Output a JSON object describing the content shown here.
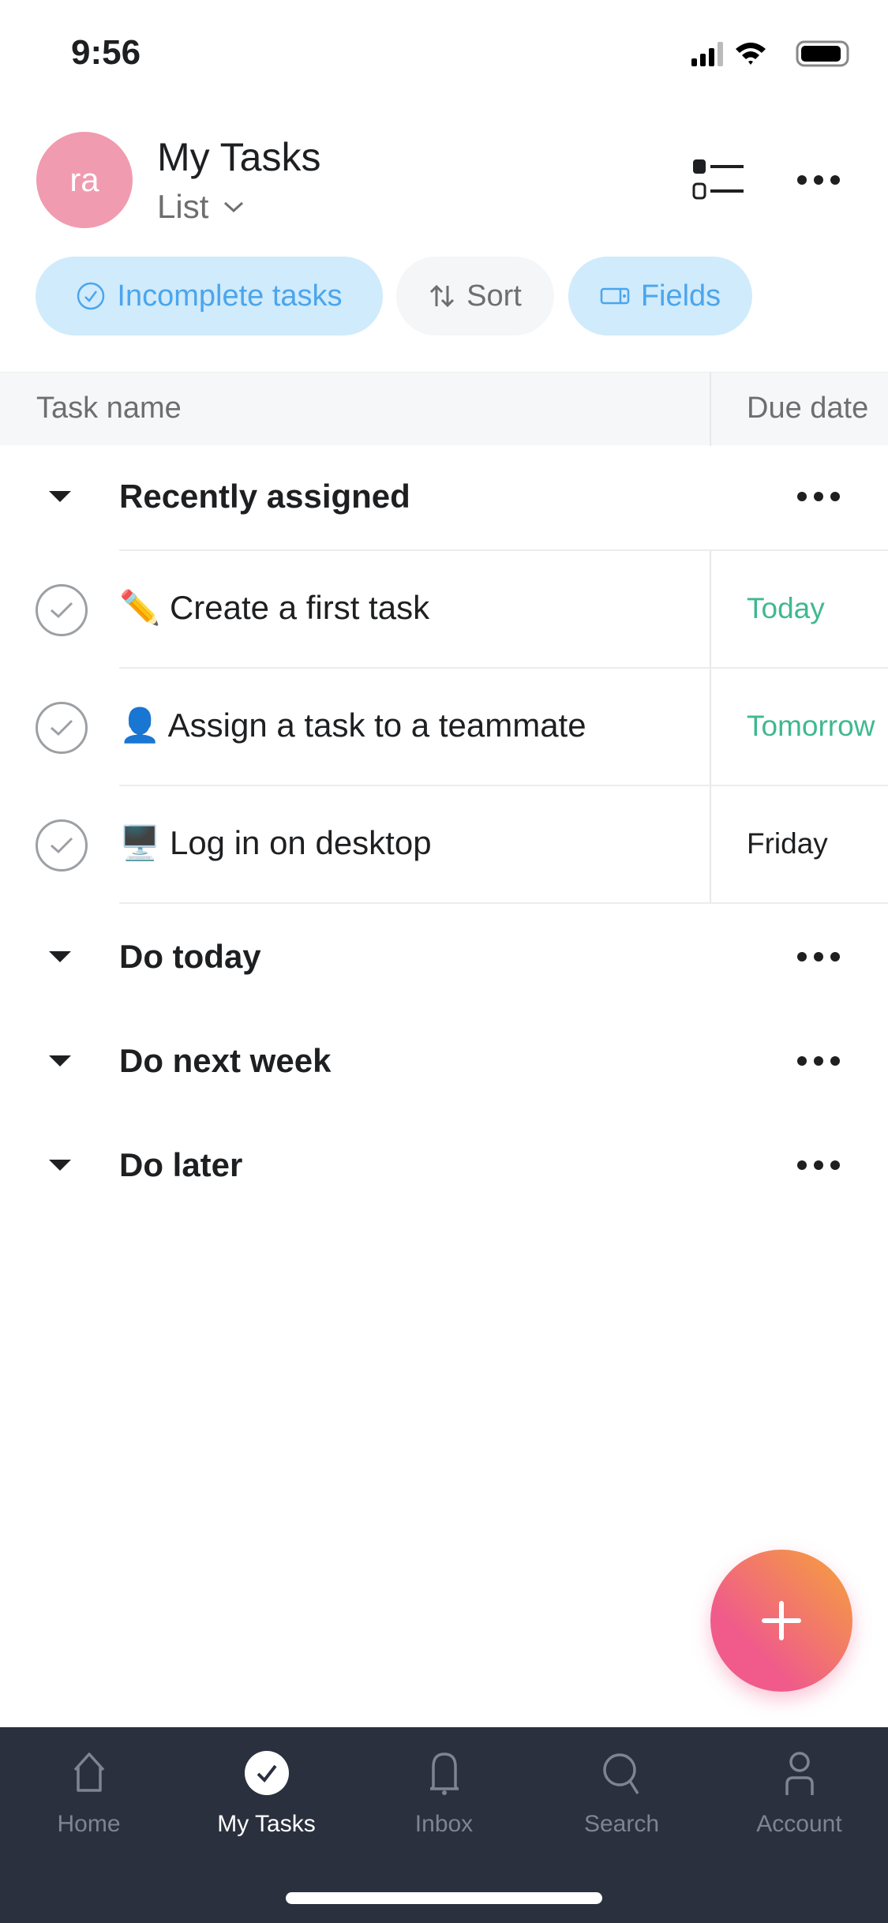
{
  "status_bar": {
    "time": "9:56"
  },
  "header": {
    "avatar_initials": "ra",
    "avatar_color": "#f09bb0",
    "title": "My Tasks",
    "view": "List"
  },
  "filters": {
    "incomplete": "Incomplete tasks",
    "sort": "Sort",
    "fields": "Fields"
  },
  "columns": {
    "task_name": "Task name",
    "due_date": "Due date"
  },
  "sections": [
    {
      "label": "Recently assigned",
      "tasks": [
        {
          "emoji": "✏️",
          "name": "Create a first task",
          "due": "Today",
          "due_color": "#3fb98f"
        },
        {
          "emoji": "👤",
          "name": "Assign a task to a teammate",
          "due": "Tomorrow",
          "due_color": "#3fb98f"
        },
        {
          "emoji": "🖥️",
          "name": "Log in on desktop",
          "due": "Friday",
          "due_color": "#1e1f21"
        }
      ]
    },
    {
      "label": "Do today"
    },
    {
      "label": "Do next week"
    },
    {
      "label": "Do later"
    }
  ],
  "tabbar": {
    "items": [
      {
        "label": "Home",
        "icon": "home-icon"
      },
      {
        "label": "My Tasks",
        "icon": "check-circle-icon",
        "active": true
      },
      {
        "label": "Inbox",
        "icon": "bell-icon"
      },
      {
        "label": "Search",
        "icon": "search-icon"
      },
      {
        "label": "Account",
        "icon": "person-icon"
      }
    ]
  }
}
